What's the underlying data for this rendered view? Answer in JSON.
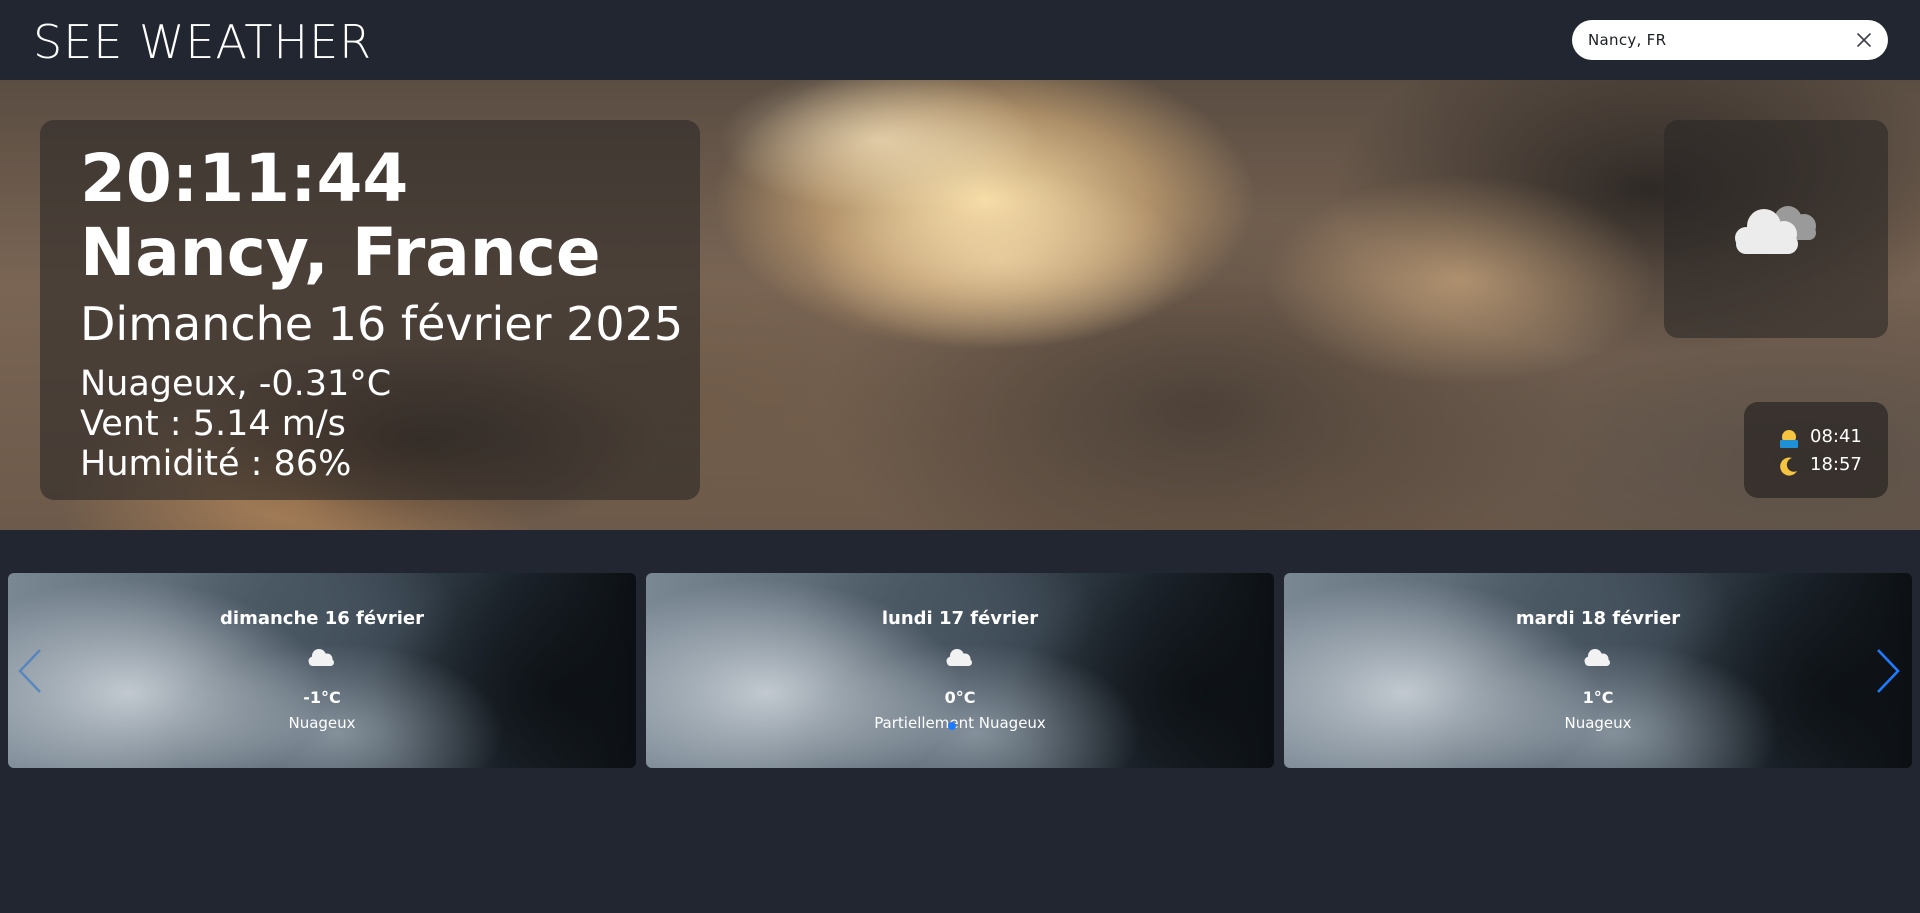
{
  "app": {
    "brand": "SEE WEATHER"
  },
  "search": {
    "value": "Nancy, FR"
  },
  "current": {
    "time": "20:11:44",
    "location": "Nancy, France",
    "date": "Dimanche 16 février 2025",
    "condition_line": "Nuageux, -0.31°C",
    "wind_line": "Vent : 5.14 m/s",
    "humidity_line": "Humidité : 86%",
    "icon": "cloudy-icon"
  },
  "sun": {
    "sunrise": "08:41",
    "sunset": "18:57"
  },
  "forecast": [
    {
      "day": "dimanche 16 février",
      "temp": "-1°C",
      "condition": "Nuageux",
      "icon": "cloud-icon"
    },
    {
      "day": "lundi 17 février",
      "temp": "0°C",
      "condition": "Partiellement Nuageux",
      "icon": "cloud-icon"
    },
    {
      "day": "mardi 18 février",
      "temp": "1°C",
      "condition": "Nuageux",
      "icon": "cloud-icon"
    }
  ],
  "colors": {
    "background": "#222630",
    "accent": "#1e7bff"
  }
}
